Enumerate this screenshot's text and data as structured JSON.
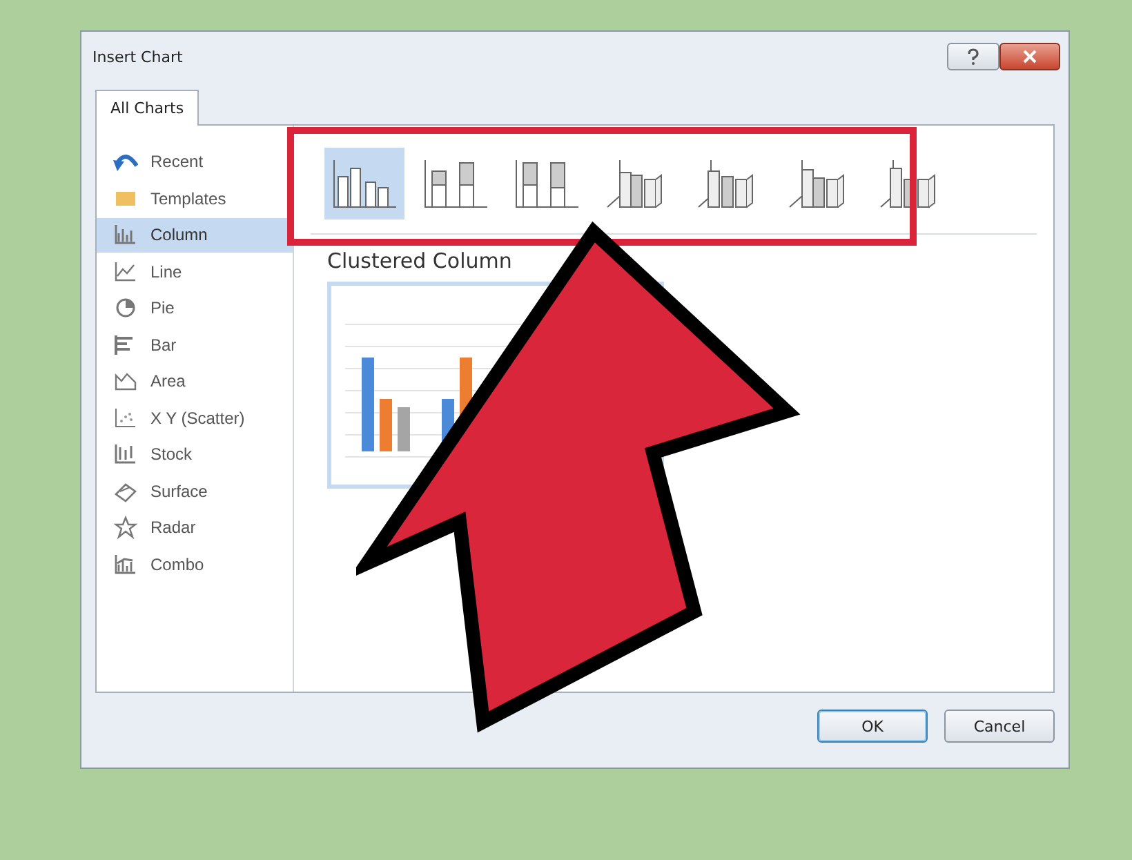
{
  "window": {
    "title": "Insert Chart"
  },
  "tabs": [
    {
      "label": "All Charts",
      "selected": true
    }
  ],
  "sidebar": {
    "items": [
      {
        "label": "Recent",
        "selected": false
      },
      {
        "label": "Templates",
        "selected": false
      },
      {
        "label": "Column",
        "selected": true
      },
      {
        "label": "Line",
        "selected": false
      },
      {
        "label": "Pie",
        "selected": false
      },
      {
        "label": "Bar",
        "selected": false
      },
      {
        "label": "Area",
        "selected": false
      },
      {
        "label": "X Y (Scatter)",
        "selected": false
      },
      {
        "label": "Stock",
        "selected": false
      },
      {
        "label": "Surface",
        "selected": false
      },
      {
        "label": "Radar",
        "selected": false
      },
      {
        "label": "Combo",
        "selected": false
      }
    ]
  },
  "subtypes": [
    {
      "selected": true
    },
    {
      "selected": false
    },
    {
      "selected": false
    },
    {
      "selected": false
    },
    {
      "selected": false
    },
    {
      "selected": false
    },
    {
      "selected": false
    }
  ],
  "subtype_title": "Clustered Column",
  "buttons": [
    {
      "label": "OK",
      "default": true
    },
    {
      "label": "Cancel",
      "default": false
    }
  ]
}
